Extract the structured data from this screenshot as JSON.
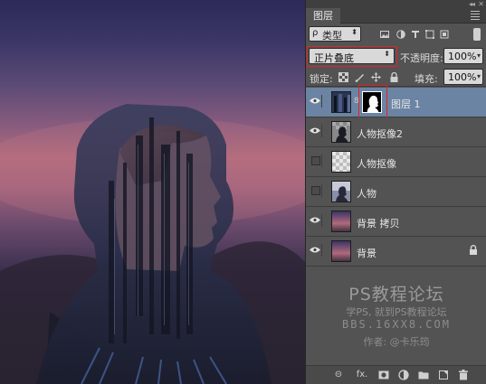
{
  "panel": {
    "tab_title": "图层",
    "collapse_glyph": "◂◂",
    "close_glyph": "✕"
  },
  "filter": {
    "search_glyph": "ρ",
    "label": "类型",
    "arrow": "⬍"
  },
  "blend_mode": {
    "value": "正片叠底",
    "arrow": "⬍"
  },
  "opacity": {
    "label": "不透明度:",
    "value": "100%",
    "arrow": "▾"
  },
  "lock": {
    "label": "锁定:"
  },
  "fill": {
    "label": "填充:",
    "value": "100%",
    "arrow": "▾"
  },
  "layers": [
    {
      "name": "图层 1",
      "visible": true,
      "selected": true,
      "has_mask": true,
      "chain": "8"
    },
    {
      "name": "人物抠像2",
      "visible": true,
      "selected": false
    },
    {
      "name": "人物抠像",
      "visible": false,
      "selected": false
    },
    {
      "name": "人物",
      "visible": false,
      "selected": false
    },
    {
      "name": "背景 拷贝",
      "visible": true,
      "selected": false
    },
    {
      "name": "背景",
      "visible": true,
      "selected": false,
      "locked": true
    }
  ],
  "watermark": {
    "line1": "PS教程论坛",
    "line2": "学PS, 就到PS教程论坛",
    "line3": "BBS.16XX8.COM",
    "line4": "作者: @卡乐筠"
  },
  "bottom_bar": {
    "link": "⊝",
    "fx": "fx."
  },
  "colors": {
    "panel_bg": "#535353",
    "selected_layer": "#6b84a3",
    "highlight_red": "#e02424"
  }
}
